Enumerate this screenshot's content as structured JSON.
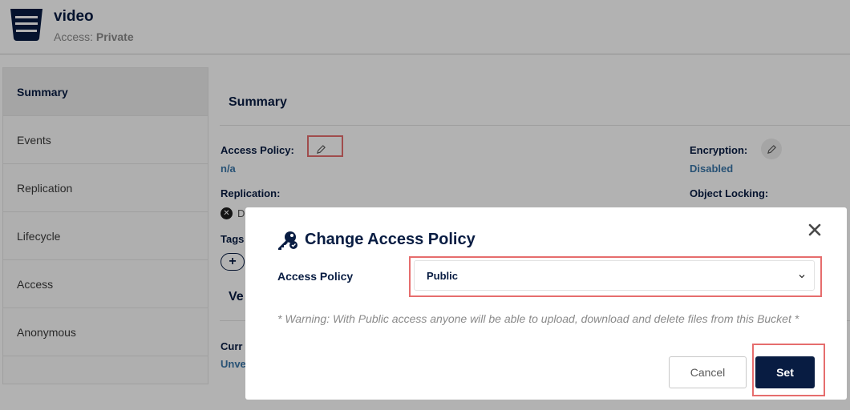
{
  "header": {
    "bucket_name": "video",
    "access_prefix": "Access:",
    "access_value": "Private",
    "icon": "bucket-icon"
  },
  "sidebar": {
    "items": [
      {
        "label": "Summary",
        "active": true
      },
      {
        "label": "Events"
      },
      {
        "label": "Replication"
      },
      {
        "label": "Lifecycle"
      },
      {
        "label": "Access"
      },
      {
        "label": "Anonymous"
      }
    ]
  },
  "summary": {
    "title": "Summary",
    "access_policy_label": "Access Policy:",
    "access_policy_value": "n/a",
    "encryption_label": "Encryption:",
    "encryption_value": "Disabled",
    "replication_label": "Replication:",
    "replication_value_partial": "D",
    "object_locking_label": "Object Locking:",
    "tags_label_partial": "Tags",
    "tag_add_symbol": "+",
    "versioning_title_partial": "Ve",
    "current_label_partial": "Curr",
    "current_value_partial": "Unve",
    "icons": {
      "edit": "pencil-icon",
      "status": "x-circle-icon"
    }
  },
  "modal": {
    "title": "Change Access Policy",
    "icon": "key-icon",
    "close_icon": "close-icon",
    "field_label": "Access Policy",
    "selected_value": "Public",
    "warning": "* Warning: With Public access anyone will be able to upload, download and delete files from this Bucket *",
    "cancel_label": "Cancel",
    "set_label": "Set"
  },
  "colors": {
    "primary": "#081c42",
    "link": "#3a76a8",
    "highlight": "#e66d6d",
    "overlay": "rgba(0,0,0,0.3)"
  }
}
